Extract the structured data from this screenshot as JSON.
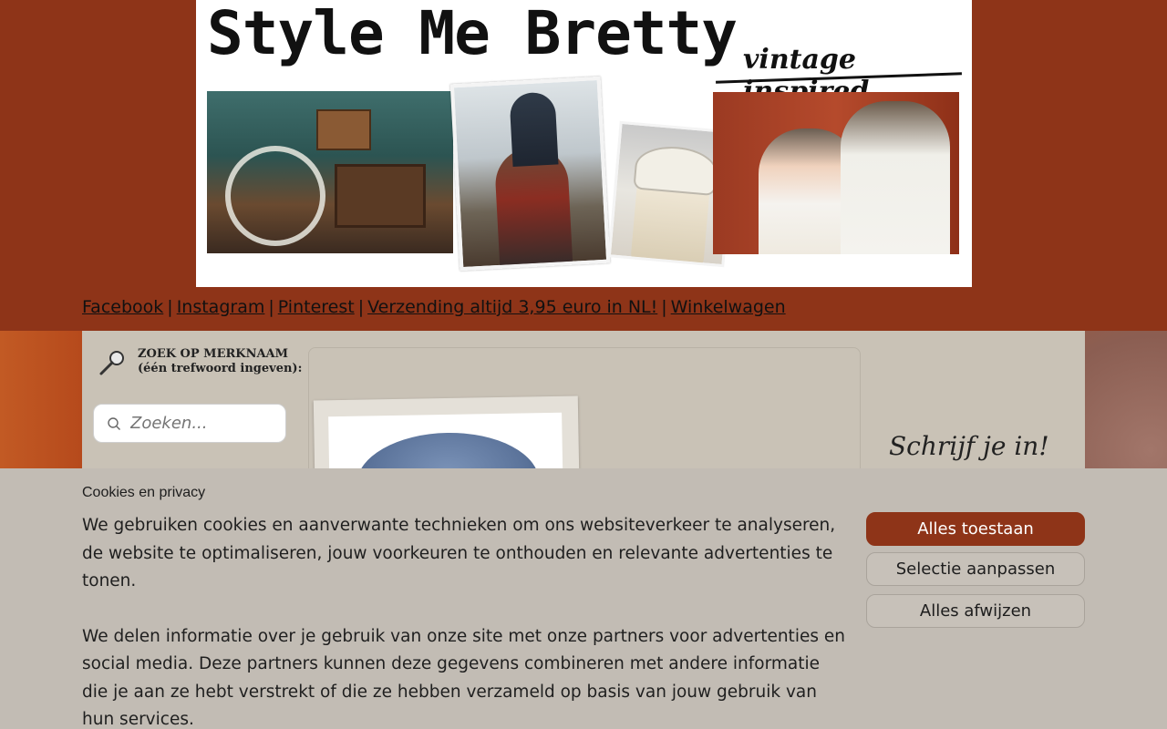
{
  "header": {
    "title": "Style Me Bretty",
    "tagline": "vintage inspired"
  },
  "nav": {
    "facebook": "Facebook",
    "instagram": "Instagram",
    "pinterest": "Pinterest",
    "shipping": "Verzending altijd 3,95 euro in NL!",
    "cart": "Winkelwagen",
    "separator": "|"
  },
  "sidebar": {
    "search_label_line1": "ZOEK OP MERKNAAM",
    "search_label_line2": "(één trefwoord ingeven):",
    "search_placeholder": "Zoeken..."
  },
  "right_panel": {
    "signup_text": "Schrijf je in!"
  },
  "cookie": {
    "title": "Cookies en privacy",
    "paragraph1": "We gebruiken cookies en aanverwante technieken om ons websiteverkeer te analyseren, de website te optimaliseren, jouw voorkeuren te onthouden en relevante advertenties te tonen.",
    "paragraph2": "We delen informatie over je gebruik van onze site met onze partners voor advertenties en social media. Deze partners kunnen deze gegevens combineren met andere informatie die je aan ze hebt verstrekt of die ze hebben verzameld op basis van jouw gebruik van hun services.",
    "allow_all": "Alles toestaan",
    "customize": "Selectie aanpassen",
    "reject_all": "Alles afwijzen"
  },
  "colors": {
    "brand": "#8e3418",
    "content_bg": "#c9c2b6",
    "cookie_bg": "#c2bcb4"
  }
}
